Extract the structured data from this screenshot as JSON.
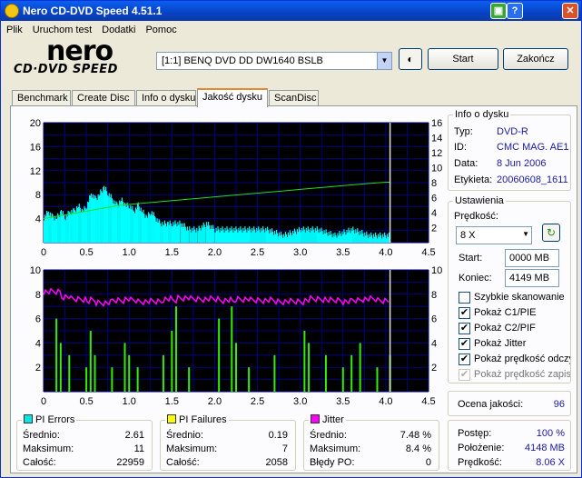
{
  "window": {
    "title": "Nero CD-DVD Speed 4.51.1"
  },
  "menu": [
    "Plik",
    "Uruchom test",
    "Dodatki",
    "Pomoc"
  ],
  "logo": {
    "top": "nero",
    "bottom": "CD·DVD SPEED"
  },
  "drive_select": {
    "value": "[1:1]  BENQ DVD DD DW1640 BSLB"
  },
  "buttons": {
    "start": "Start",
    "end": "Zakończ"
  },
  "tabs": [
    "Benchmark",
    "Create Disc",
    "Info o dysku",
    "Jakość dysku",
    "ScanDisc"
  ],
  "active_tab": "Jakość dysku",
  "disc_info": {
    "title": "Info o dysku",
    "labels": {
      "type": "Typ:",
      "id": "ID:",
      "date": "Data:",
      "label": "Etykieta:"
    },
    "values": {
      "type": "DVD-R",
      "id": "CMC MAG. AE1",
      "date": "8 Jun 2006",
      "label": "20060608_1611"
    }
  },
  "settings": {
    "title": "Ustawienia",
    "speed_label": "Prędkość:",
    "speed_value": "8 X",
    "start_label": "Start:",
    "start_value": "0000 MB",
    "end_label": "Koniec:",
    "end_value": "4149 MB",
    "checkboxes": [
      {
        "label": "Szybkie skanowanie",
        "checked": false,
        "enabled": true
      },
      {
        "label": "Pokaż C1/PIE",
        "checked": true,
        "enabled": true
      },
      {
        "label": "Pokaż C2/PIF",
        "checked": true,
        "enabled": true
      },
      {
        "label": "Pokaż Jitter",
        "checked": true,
        "enabled": true
      },
      {
        "label": "Pokaż prędkość odczytu",
        "checked": true,
        "enabled": true
      },
      {
        "label": "Pokaż prędkość zapisu",
        "checked": true,
        "enabled": false
      }
    ]
  },
  "quality": {
    "label": "Ocena jakości:",
    "value": "96"
  },
  "pi_errors": {
    "title": "PI Errors",
    "color": "#00e5e5",
    "avg_label": "Średnio:",
    "avg": "2.61",
    "max_label": "Maksimum:",
    "max": "11",
    "total_label": "Całość:",
    "total": "22959"
  },
  "pi_failures": {
    "title": "PI Failures",
    "color": "#ffff00",
    "avg_label": "Średnio:",
    "avg": "0.19",
    "max_label": "Maksimum:",
    "max": "7",
    "total_label": "Całość:",
    "total": "2058"
  },
  "jitter": {
    "title": "Jitter",
    "color": "#ff00ff",
    "avg_label": "Średnio:",
    "avg": "7.48 %",
    "max_label": "Maksimum:",
    "max": "8.4 %",
    "po_label": "Błędy PO:",
    "po": "0"
  },
  "progress": {
    "progress_label": "Postęp:",
    "progress": "100 %",
    "position_label": "Położenie:",
    "position": "4148 MB",
    "speed_label": "Prędkość:",
    "speed": "8.06 X"
  },
  "chart_data": [
    {
      "type": "area",
      "name": "PI Errors / read speed",
      "x": [
        0,
        0.05,
        0.1,
        0.15,
        0.2,
        0.25,
        0.3,
        0.35,
        0.4,
        0.45,
        0.5,
        0.55,
        0.6,
        0.65,
        0.7,
        0.75,
        0.8,
        0.85,
        0.9,
        0.95,
        1.0,
        1.05,
        1.1,
        1.15,
        1.2,
        1.25,
        1.3,
        1.35,
        1.4,
        1.45,
        1.5,
        1.6,
        1.7,
        1.8,
        1.9,
        2.0,
        2.2,
        2.4,
        2.6,
        2.8,
        3.0,
        3.2,
        3.4,
        3.6,
        3.8,
        4.0,
        4.05
      ],
      "series": [
        {
          "name": "PI Errors",
          "color": "#00ffff",
          "values": [
            4,
            5,
            4,
            4,
            5,
            4,
            5,
            5,
            6,
            5,
            6,
            8,
            7,
            8,
            9,
            8,
            7,
            6,
            7,
            6,
            6,
            5,
            6,
            5,
            4,
            5,
            4,
            3,
            3,
            3,
            3,
            3,
            2,
            2,
            3,
            2,
            2,
            2,
            2,
            1,
            2,
            2,
            1,
            2,
            1,
            1,
            1
          ]
        },
        {
          "name": "Read speed",
          "color": "#22dd22",
          "values": [
            3.2,
            3.3,
            3.4,
            3.5,
            3.6,
            3.7,
            3.8,
            3.9,
            4.0,
            4.1,
            4.2,
            4.3,
            4.4,
            4.5,
            4.6,
            4.7,
            4.8,
            4.9,
            5.0,
            5.05,
            5.1,
            5.15,
            5.2,
            5.25,
            5.3,
            5.35,
            5.4,
            5.45,
            5.5,
            5.55,
            5.6,
            5.7,
            5.8,
            5.9,
            6.0,
            6.1,
            6.3,
            6.5,
            6.7,
            6.9,
            7.1,
            7.3,
            7.5,
            7.7,
            7.9,
            8.06,
            8.06
          ]
        }
      ],
      "xlim": [
        0,
        4.5
      ],
      "ylim": [
        0,
        20
      ],
      "y2lim": [
        0,
        16
      ],
      "xticks": [
        "0",
        "0.5",
        "1.0",
        "1.5",
        "2.0",
        "2.5",
        "3.0",
        "3.5",
        "4.0",
        "4.5"
      ],
      "yticks": [
        "20",
        "16",
        "12",
        "8",
        "4"
      ],
      "y2ticks": [
        "16",
        "14",
        "12",
        "10",
        "8",
        "6",
        "4",
        "2"
      ]
    },
    {
      "type": "bar",
      "name": "PI Failures / Jitter",
      "x": [
        0.15,
        0.2,
        0.3,
        0.5,
        0.55,
        0.6,
        0.8,
        0.95,
        1.0,
        1.1,
        1.4,
        1.5,
        1.55,
        1.7,
        2.05,
        2.2,
        2.25,
        2.4,
        2.7,
        3.05,
        3.1,
        3.3,
        3.5,
        3.6,
        3.7,
        3.9,
        4.05
      ],
      "series": [
        {
          "name": "PI Failures",
          "color": "#33ee00",
          "values": [
            6,
            4,
            3,
            2,
            5,
            3,
            2,
            4,
            3,
            2,
            3,
            5,
            7,
            2,
            6,
            7,
            4,
            2,
            3,
            5,
            4,
            3,
            2,
            3,
            4,
            2,
            3
          ]
        },
        {
          "name": "Jitter",
          "color": "#ff00ff",
          "values": [
            8.2,
            7.8,
            7.6,
            7.4,
            7.5,
            7.3,
            7.5,
            7.6,
            7.5,
            7.4,
            7.6,
            7.5,
            7.7,
            7.6,
            7.5,
            7.4,
            7.6,
            7.5,
            7.4,
            7.5,
            7.6,
            7.5,
            7.4,
            7.5,
            7.6,
            7.5,
            7.6
          ]
        }
      ],
      "xlim": [
        0,
        4.5
      ],
      "ylim": [
        0,
        10
      ],
      "y2lim": [
        0,
        10
      ],
      "xticks": [
        "0",
        "0.5",
        "1.0",
        "1.5",
        "2.0",
        "2.5",
        "3.0",
        "3.5",
        "4.0",
        "4.5"
      ],
      "yticks": [
        "10",
        "8",
        "6",
        "4",
        "2"
      ],
      "y2ticks": [
        "10",
        "8",
        "6",
        "4",
        "2"
      ]
    }
  ]
}
